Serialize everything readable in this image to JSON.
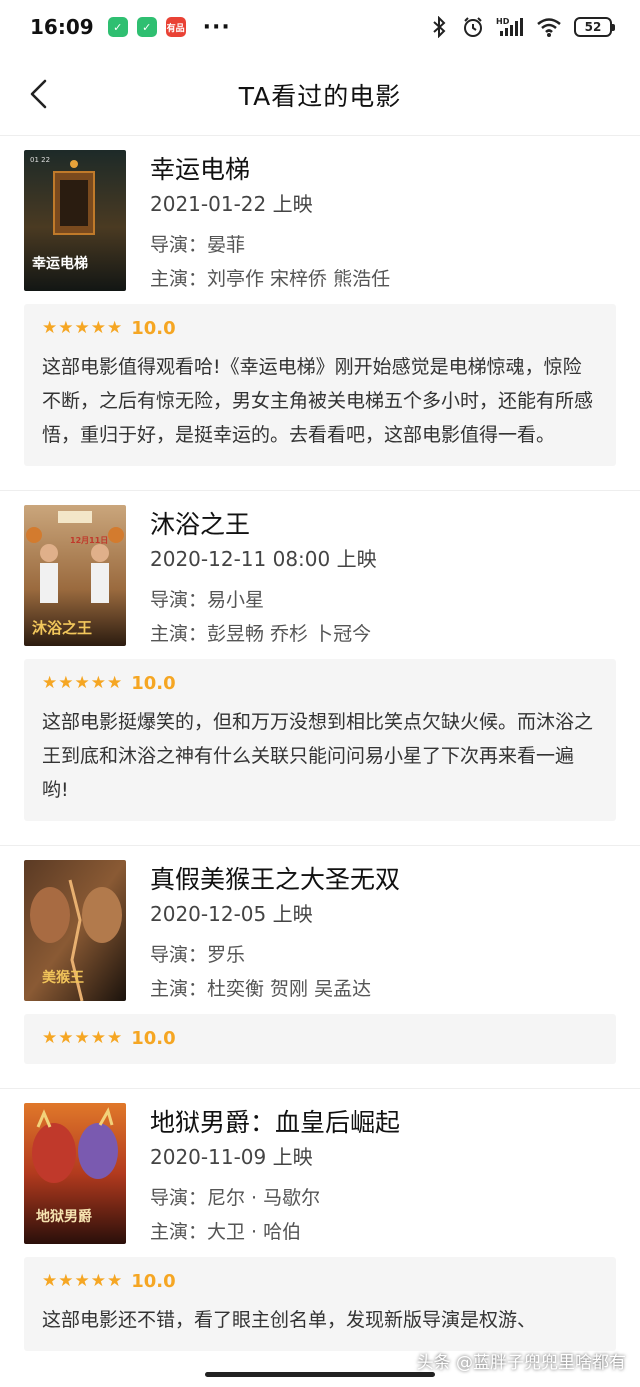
{
  "status_bar": {
    "time": "16:09",
    "badge_app_3": "有品",
    "battery": "52",
    "network": "HD"
  },
  "nav": {
    "title": "TA看过的电影"
  },
  "movies": [
    {
      "title": "幸运电梯",
      "release": "2021-01-22 上映",
      "director": "导演：晏菲",
      "cast": "主演：刘亭作 宋梓侨 熊浩任",
      "stars": "★★★★★",
      "score": "10.0",
      "review": "这部电影值得观看哈!《幸运电梯》刚开始感觉是电梯惊魂，惊险不断，之后有惊无险，男女主角被关电梯五个多小时，还能有所感悟，重归于好，是挺幸运的。去看看吧，这部电影值得一看。",
      "poster_caption": "幸运电梯",
      "poster_date": "01 22"
    },
    {
      "title": "沐浴之王",
      "release": "2020-12-11 08:00 上映",
      "director": "导演：易小星",
      "cast": "主演：彭昱畅 乔杉 卜冠今",
      "stars": "★★★★★",
      "score": "10.0",
      "review": "这部电影挺爆笑的，但和万万没想到相比笑点欠缺火候。而沐浴之王到底和沐浴之神有什么关联只能问问易小星了下次再来看一遍哟!",
      "poster_caption": "沐浴之王",
      "poster_date": "12月11日"
    },
    {
      "title": "真假美猴王之大圣无双",
      "release": "2020-12-05 上映",
      "director": "导演：罗乐",
      "cast": "主演：杜奕衡 贺刚 吴孟达",
      "stars": "★★★★★",
      "score": "10.0",
      "review": "",
      "poster_caption": "美猴王"
    },
    {
      "title": "地狱男爵：血皇后崛起",
      "release": "2020-11-09 上映",
      "director": "导演：尼尔 · 马歇尔",
      "cast": "主演：大卫 · 哈伯",
      "stars": "★★★★★",
      "score": "10.0",
      "review": "这部电影还不错，看了眼主创名单，发现新版导演是权游、",
      "poster_caption": "地狱男爵"
    }
  ],
  "watermark": "头条 @蓝胖子兜兜里啥都有",
  "colors": {
    "accent_star": "#f5a623",
    "review_bg": "#f5f5f5"
  }
}
